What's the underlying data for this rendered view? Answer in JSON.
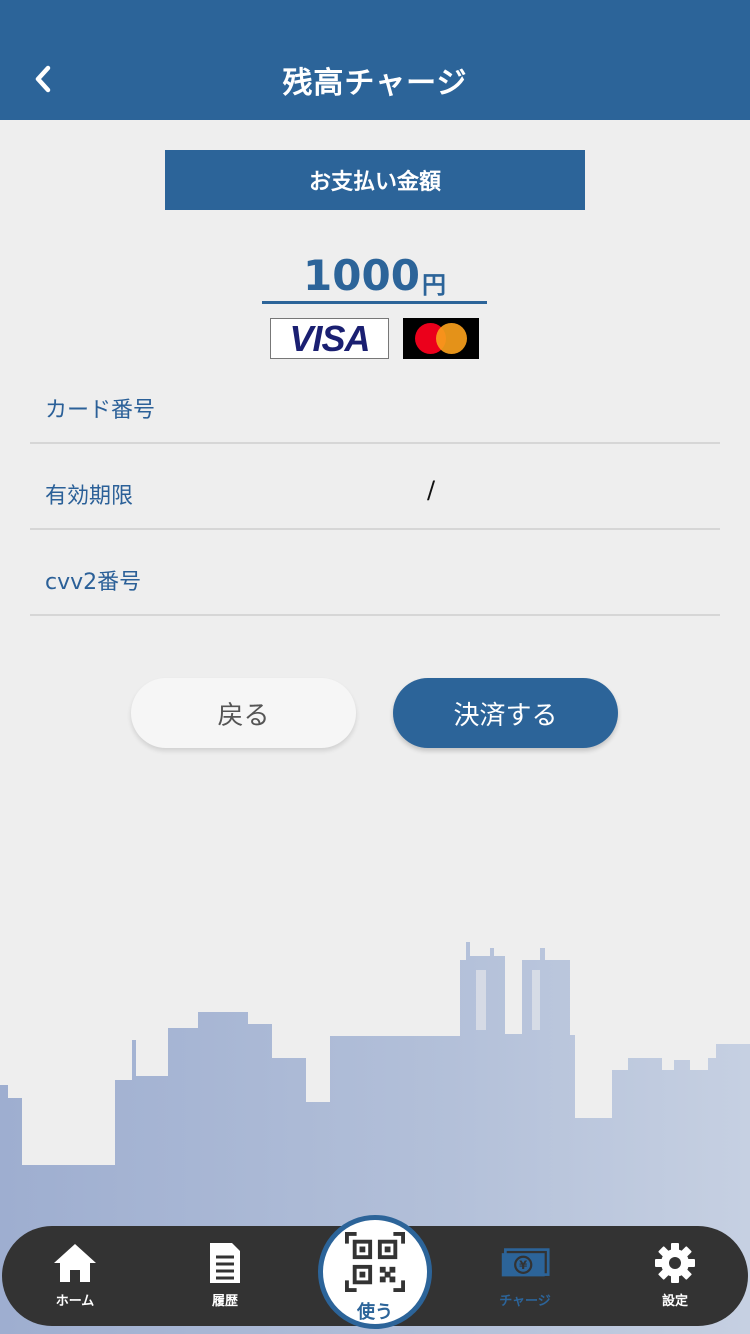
{
  "header": {
    "title": "残高チャージ"
  },
  "payment": {
    "section_title": "お支払い金額",
    "amount": "1000",
    "currency": "円",
    "card_brands": [
      "VISA",
      "mastercard"
    ]
  },
  "form": {
    "card_number_label": "カード番号",
    "expiry_label": "有効期限",
    "expiry_separator": "/",
    "cvv_label": "cvv2番号"
  },
  "buttons": {
    "back": "戻る",
    "pay": "決済する"
  },
  "tabbar": {
    "home": "ホーム",
    "history": "履歴",
    "use": "使う",
    "charge": "チャージ",
    "settings": "設定",
    "active": "charge"
  },
  "colors": {
    "primary": "#2c6499",
    "background": "#eeeeee",
    "tabbar": "#333333",
    "skyline": "#a8b6d3"
  }
}
